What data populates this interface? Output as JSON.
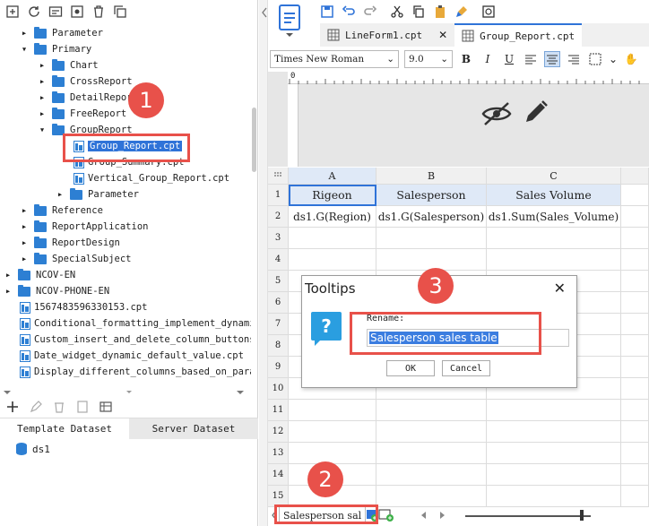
{
  "left_toolbar": {
    "icons": [
      "add-icon",
      "refresh-icon",
      "folder-icon",
      "settings-icon",
      "delete-icon",
      "copy-icon"
    ]
  },
  "tree": {
    "items": [
      {
        "label": "Parameter",
        "type": "folder",
        "expanded": false
      },
      {
        "label": "Primary",
        "type": "folder",
        "expanded": true
      },
      {
        "label": "Chart",
        "type": "folder",
        "expanded": false
      },
      {
        "label": "CrossReport",
        "type": "folder",
        "expanded": false
      },
      {
        "label": "DetailReport",
        "type": "folder",
        "expanded": false
      },
      {
        "label": "FreeReport",
        "type": "folder",
        "expanded": false
      },
      {
        "label": "GroupReport",
        "type": "folder",
        "expanded": true
      },
      {
        "label": "Group_Report.cpt",
        "type": "file",
        "selected": true
      },
      {
        "label": "Group_Summary.cpt",
        "type": "file"
      },
      {
        "label": "Vertical_Group_Report.cpt",
        "type": "file"
      },
      {
        "label": "Parameter",
        "type": "folder",
        "expanded": false
      },
      {
        "label": "Reference",
        "type": "folder",
        "expanded": false
      },
      {
        "label": "ReportApplication",
        "type": "folder",
        "expanded": false
      },
      {
        "label": "ReportDesign",
        "type": "folder",
        "expanded": false
      },
      {
        "label": "SpecialSubject",
        "type": "folder",
        "expanded": false
      },
      {
        "label": "NCOV-EN",
        "type": "folder",
        "expanded": false
      },
      {
        "label": "NCOV-PHONE-EN",
        "type": "folder",
        "expanded": false
      },
      {
        "label": "1567483596330153.cpt",
        "type": "file"
      },
      {
        "label": "Conditional_formatting_implement_dynamic",
        "type": "file"
      },
      {
        "label": "Custom_insert_and_delete_column_buttons.",
        "type": "file"
      },
      {
        "label": "Date_widget_dynamic_default_value.cpt",
        "type": "file"
      },
      {
        "label": "Display_different_columns_based_on_param",
        "type": "file"
      }
    ]
  },
  "dataset_tabs": {
    "template": "Template Dataset",
    "server": "Server Dataset"
  },
  "datasets": [
    {
      "name": "ds1"
    }
  ],
  "file_tabs": [
    {
      "label": "LineForm1.cpt",
      "active": false
    },
    {
      "label": "Group_Report.cpt",
      "active": true
    }
  ],
  "format": {
    "font": "Times New Roman",
    "size": "9.0",
    "bold": "B",
    "italic": "I",
    "underline": "U"
  },
  "ruler": {
    "zero": "0"
  },
  "sheet": {
    "columns": [
      "A",
      "B",
      "C"
    ],
    "rows": [
      "1",
      "2",
      "3",
      "4",
      "5",
      "6",
      "7",
      "8",
      "9",
      "10",
      "11",
      "12",
      "13",
      "14",
      "15"
    ],
    "cells": [
      [
        "Rigeon",
        "Salesperson",
        "Sales Volume"
      ],
      [
        "ds1.G(Region)",
        "ds1.G(Salesperson)",
        "ds1.Sum(Sales_Volume)"
      ]
    ]
  },
  "sheet_tab": {
    "label": "Salesperson sal"
  },
  "dialog": {
    "title": "Tooltips",
    "rename_label": "Rename:",
    "input_value": "Salesperson sales table",
    "ok": "OK",
    "cancel": "Cancel"
  },
  "markers": [
    "1",
    "2",
    "3"
  ],
  "colors": {
    "accent": "#2f73d8",
    "folder": "#2d7fd3",
    "marker": "#e8514a",
    "header_fill": "#dfe9f7"
  }
}
